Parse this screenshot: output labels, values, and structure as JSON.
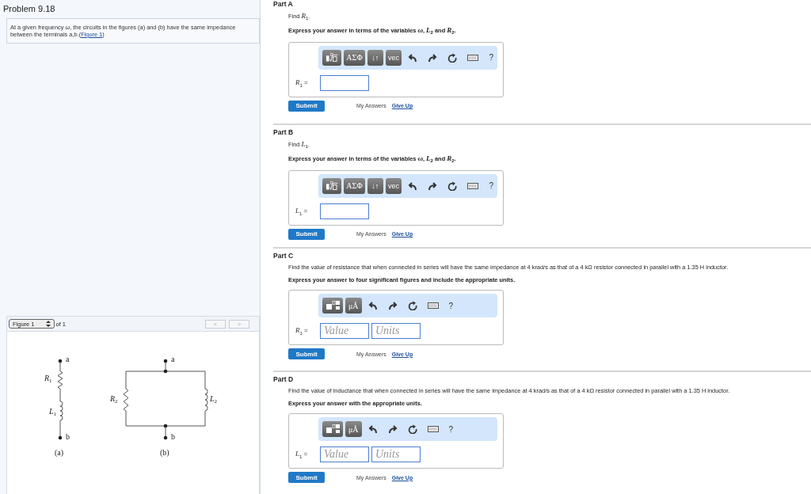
{
  "problem": {
    "title": "Problem 9.18",
    "intro": "At a given frequency *ω*, the circuits in the figures (a) and (b) have the same impedance between the terminals a,b.(",
    "link": "Figure 1",
    "after": ")"
  },
  "figure": {
    "select": "Figure 1",
    "of": "of 1",
    "prev": "<",
    "next": ">",
    "labels": [
      "a",
      "*R*$_{1}$",
      "*L*$_{1}$",
      "b",
      "(a)",
      "a",
      "*R*$_{2}$",
      "*L*$_{2}$",
      "b",
      "(b)"
    ]
  },
  "parts": [
    {
      "title": "Part A",
      "prompt": "Find *R*$_{1}$.",
      "instruction": "Express your answer in terms of the variables *ω*, *L*$_{2}$ and *R*$_{2}$.",
      "tools": [
        {
          "kind": "root"
        },
        {
          "kind": "symbol",
          "label": "ΑΣΦ"
        },
        {
          "kind": "text",
          "label": "↓↑"
        },
        {
          "kind": "text",
          "label": "vec"
        },
        {
          "kind": "undo"
        },
        {
          "kind": "redo"
        },
        {
          "kind": "reset"
        },
        {
          "kind": "keyboard"
        },
        {
          "kind": "help",
          "label": "?"
        }
      ],
      "answer_label": "*R*$_{1}$ =",
      "fields": [
        {
          "kind": "expression"
        }
      ],
      "submit": "Submit",
      "my_answers": "My Answers",
      "give_up": "Give Up"
    },
    {
      "title": "Part B",
      "prompt": "Find *L*$_{1}$.",
      "instruction": "Express your answer in terms of the variables *ω*, *L*$_{2}$ and *R*$_{2}$.",
      "tools": [
        {
          "kind": "root"
        },
        {
          "kind": "symbol",
          "label": "ΑΣΦ"
        },
        {
          "kind": "text",
          "label": "↓↑"
        },
        {
          "kind": "text",
          "label": "vec"
        },
        {
          "kind": "undo"
        },
        {
          "kind": "redo"
        },
        {
          "kind": "reset"
        },
        {
          "kind": "keyboard"
        },
        {
          "kind": "help",
          "label": "?"
        }
      ],
      "answer_label": "*L*$_{1}$ =",
      "fields": [
        {
          "kind": "expression"
        }
      ],
      "submit": "Submit",
      "my_answers": "My Answers",
      "give_up": "Give Up"
    },
    {
      "title": "Part C",
      "prompt": "Find the value of resistance that when connected in series will have the same impedance at 4 krad/s as that of a 4 kΩ resistor connected in parallel with a 1.35 H inductor.",
      "instruction": "Express your answer to four significant figures and include the appropriate units.",
      "tools": [
        {
          "kind": "units-template"
        },
        {
          "kind": "symbol",
          "label": "μÅ"
        },
        {
          "kind": "undo"
        },
        {
          "kind": "redo"
        },
        {
          "kind": "reset"
        },
        {
          "kind": "keyboard"
        },
        {
          "kind": "help",
          "label": "?"
        }
      ],
      "answer_label": "*R*$_{1}$ =",
      "fields": [
        {
          "kind": "value",
          "placeholder": "Value"
        },
        {
          "kind": "units",
          "placeholder": "Units"
        }
      ],
      "submit": "Submit",
      "my_answers": "My Answers",
      "give_up": "Give Up"
    },
    {
      "title": "Part D",
      "prompt": "Find the value of inductance that when connected in series will have the same impedance at 4 krad/s as that of a 4 kΩ resistor connected in parallel with a 1.35 H inductor.",
      "instruction": "Express your answer with the appropriate units.",
      "tools": [
        {
          "kind": "units-template"
        },
        {
          "kind": "symbol",
          "label": "μÅ"
        },
        {
          "kind": "undo"
        },
        {
          "kind": "redo"
        },
        {
          "kind": "reset"
        },
        {
          "kind": "keyboard"
        },
        {
          "kind": "help",
          "label": "?"
        }
      ],
      "answer_label": "*L*$_{1}$ =",
      "fields": [
        {
          "kind": "value",
          "placeholder": "Value"
        },
        {
          "kind": "units",
          "placeholder": "Units"
        }
      ],
      "submit": "Submit",
      "my_answers": "My Answers",
      "give_up": "Give Up"
    }
  ]
}
